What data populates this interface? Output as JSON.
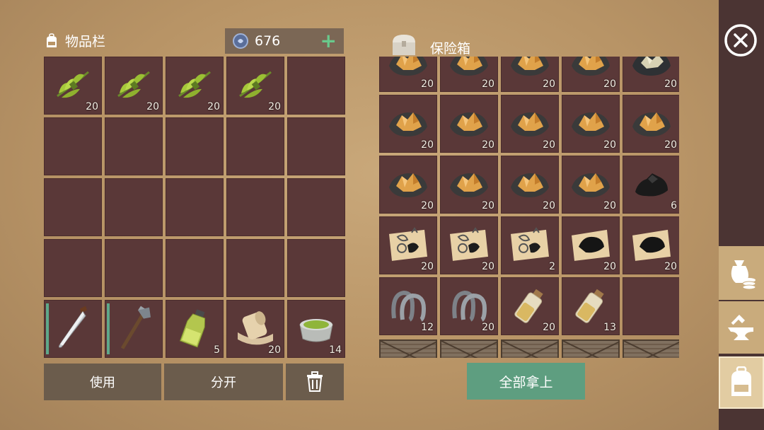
{
  "inventory": {
    "title": "物品栏",
    "coins": "676",
    "coins_plus": "+",
    "rows": [
      [
        {
          "item": "plant-bundle",
          "count": "20"
        },
        {
          "item": "plant-bundle",
          "count": "20"
        },
        {
          "item": "plant-bundle",
          "count": "20"
        },
        {
          "item": "plant-bundle",
          "count": "20"
        },
        {
          "item": "empty",
          "count": ""
        }
      ],
      [
        {
          "item": "empty",
          "count": ""
        },
        {
          "item": "empty",
          "count": ""
        },
        {
          "item": "empty",
          "count": ""
        },
        {
          "item": "empty",
          "count": ""
        },
        {
          "item": "empty",
          "count": ""
        }
      ],
      [
        {
          "item": "empty",
          "count": ""
        },
        {
          "item": "empty",
          "count": ""
        },
        {
          "item": "empty",
          "count": ""
        },
        {
          "item": "empty",
          "count": ""
        },
        {
          "item": "empty",
          "count": ""
        }
      ],
      [
        {
          "item": "empty",
          "count": ""
        },
        {
          "item": "empty",
          "count": ""
        },
        {
          "item": "empty",
          "count": ""
        },
        {
          "item": "empty",
          "count": ""
        },
        {
          "item": "empty",
          "count": ""
        }
      ],
      [
        {
          "item": "machete",
          "count": "",
          "durability": true
        },
        {
          "item": "hatchet",
          "count": "",
          "durability": true
        },
        {
          "item": "oil-bottle",
          "count": "5"
        },
        {
          "item": "cloth-roll",
          "count": "20"
        },
        {
          "item": "paste-bowl",
          "count": "14"
        }
      ]
    ],
    "use_label": "使用",
    "split_label": "分开"
  },
  "chest": {
    "title": "保险箱",
    "rows": [
      [
        {
          "item": "copper-ore",
          "count": "20"
        },
        {
          "item": "copper-ore",
          "count": "20"
        },
        {
          "item": "copper-ore",
          "count": "20"
        },
        {
          "item": "copper-ore",
          "count": "20"
        },
        {
          "item": "silver-ore",
          "count": "20"
        }
      ],
      [
        {
          "item": "copper-ore",
          "count": "20"
        },
        {
          "item": "copper-ore",
          "count": "20"
        },
        {
          "item": "copper-ore",
          "count": "20"
        },
        {
          "item": "copper-ore",
          "count": "20"
        },
        {
          "item": "copper-ore",
          "count": "20"
        }
      ],
      [
        {
          "item": "copper-ore",
          "count": "20"
        },
        {
          "item": "copper-ore",
          "count": "20"
        },
        {
          "item": "copper-ore",
          "count": "20"
        },
        {
          "item": "copper-ore",
          "count": "20"
        },
        {
          "item": "coal",
          "count": "6"
        }
      ],
      [
        {
          "item": "blueprint",
          "count": "20"
        },
        {
          "item": "blueprint",
          "count": "20"
        },
        {
          "item": "blueprint",
          "count": "2"
        },
        {
          "item": "coal-paper",
          "count": "20"
        },
        {
          "item": "coal-paper",
          "count": "20"
        }
      ],
      [
        {
          "item": "horseshoe",
          "count": "12"
        },
        {
          "item": "horseshoe",
          "count": "20"
        },
        {
          "item": "vial",
          "count": "20"
        },
        {
          "item": "vial",
          "count": "13"
        },
        {
          "item": "empty",
          "count": ""
        }
      ]
    ],
    "take_all_label": "全部拿上"
  },
  "colors": {
    "accent_green": "#5e9e80",
    "slot": "#5a3838",
    "sidebar": "#4b3433"
  }
}
